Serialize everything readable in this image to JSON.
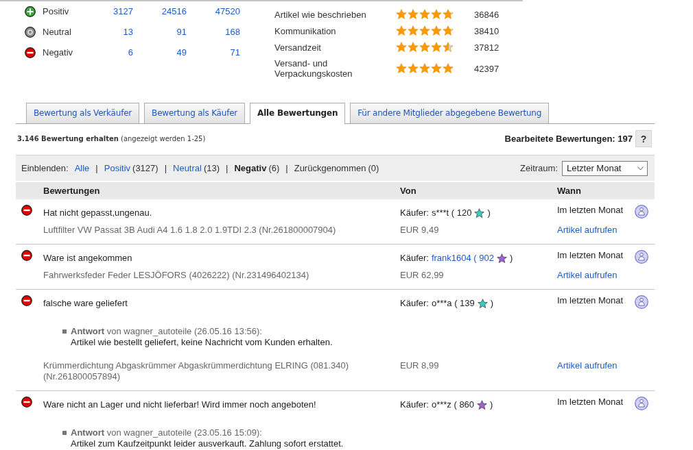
{
  "summary": {
    "rows": [
      {
        "kind": "positive",
        "label": "Positiv",
        "counts": [
          "3127",
          "24516",
          "47520"
        ]
      },
      {
        "kind": "neutral",
        "label": "Neutral",
        "counts": [
          "13",
          "91",
          "168"
        ]
      },
      {
        "kind": "negative",
        "label": "Negativ",
        "counts": [
          "6",
          "49",
          "71"
        ]
      }
    ]
  },
  "detailed_ratings": [
    {
      "label": "Artikel wie beschrieben",
      "stars": 4.8,
      "count": "36846"
    },
    {
      "label": "Kommunikation",
      "stars": 4.8,
      "count": "38410"
    },
    {
      "label": "Versandzeit",
      "stars": 4.6,
      "count": "37812"
    },
    {
      "label": "Versand- und Verpackungskosten",
      "stars": 5,
      "count": "42397"
    }
  ],
  "tabs": [
    {
      "label": "Bewertung als Verkäufer",
      "selected": false
    },
    {
      "label": "Bewertung als Käufer",
      "selected": false
    },
    {
      "label": "Alle Bewertungen",
      "selected": true
    },
    {
      "label": "Für andere Mitglieder abgegebene Bewertung",
      "selected": false
    }
  ],
  "received": {
    "text": "**3.146 Bewertung erhalten** (angezeigt werden 1-25)",
    "edited": "Bearbeitete Bewertungen: 197",
    "help": "?"
  },
  "filter": {
    "label": "Einblenden:",
    "items": [
      {
        "label": "Alle",
        "selected": false,
        "disabled": false
      },
      {
        "separator": "|",
        "label": "Positiv",
        "count": "(3127)",
        "selected": false,
        "disabled": false
      },
      {
        "separator": "|",
        "label": "Neutral",
        "count": "(13)",
        "selected": false,
        "disabled": false
      },
      {
        "separator": "|",
        "label": "Negativ",
        "count": "(6)",
        "selected": true,
        "disabled": false
      },
      {
        "separator": "|",
        "label": "Zurückgenommen",
        "count": "(0)",
        "selected": false,
        "disabled": true
      }
    ],
    "period_label": "Zeitraum:",
    "period_value": "Letzter Monat"
  },
  "table": {
    "columns": [
      "Bewertungen",
      "Von",
      "Wann"
    ],
    "rows": [
      {
        "kind": "negative",
        "comment": "Hat nicht gepasst,ungenau.",
        "buyer_label": "Käufer:",
        "buyer": "s***t ( 120",
        "buyer_linked": false,
        "color": "#3cc9c0",
        "close": ")",
        "when": "Im letzten Monat",
        "item": "Luftfilter VW Passat 3B Audi A4 1.6 1.8 2.0 1.9TDI 2.3 (Nr.261800007904)",
        "price": "EUR 9,49",
        "link": "Artikel aufrufen"
      },
      {
        "kind": "negative",
        "comment": "Ware ist angekommen",
        "buyer_label": "Käufer:",
        "buyer": "frank1604 ( 902",
        "buyer_linked": true,
        "color": "#a060d8",
        "close": ")",
        "when": "Im letzten Monat",
        "item": "Fahrwerksfeder Feder LESJÖFORS (4026222) (Nr.231496402134)",
        "price": "EUR 62,99",
        "link": "Artikel aufrufen"
      },
      {
        "kind": "negative",
        "comment": "falsche ware geliefert",
        "buyer_label": "Käufer:",
        "buyer": "o***a ( 139",
        "buyer_linked": false,
        "color": "#3cc9c0",
        "close": ")",
        "when": "Im letzten Monat",
        "reply": {
          "header": "**Antwort** von wagner_autoteile (26.05.16 13:56):",
          "text": "Artikel wie bestellt geliefert, keine Nachricht vom Kunden erhalten."
        },
        "item": "Krümmerdichtung Abgaskrümmer Abgaskrümmerdichtung ELRING (081.340) (Nr.261800057894)",
        "price": "EUR 8,99",
        "link": "Artikel aufrufen"
      },
      {
        "kind": "negative",
        "comment": "Ware nicht an Lager und nicht lieferbar! Wird immer noch angeboten!",
        "buyer_label": "Käufer:",
        "buyer": "o***z ( 860",
        "buyer_linked": false,
        "color": "#a060d8",
        "close": ")",
        "when": "Im letzten Monat",
        "reply": {
          "header": "**Antwort** von wagner_autoteile (23.05.16 15:09):",
          "text": "Artikel zum Kaufzeitpunkt leider ausverkauft. Zahlung sofort erstattet."
        }
      }
    ]
  }
}
